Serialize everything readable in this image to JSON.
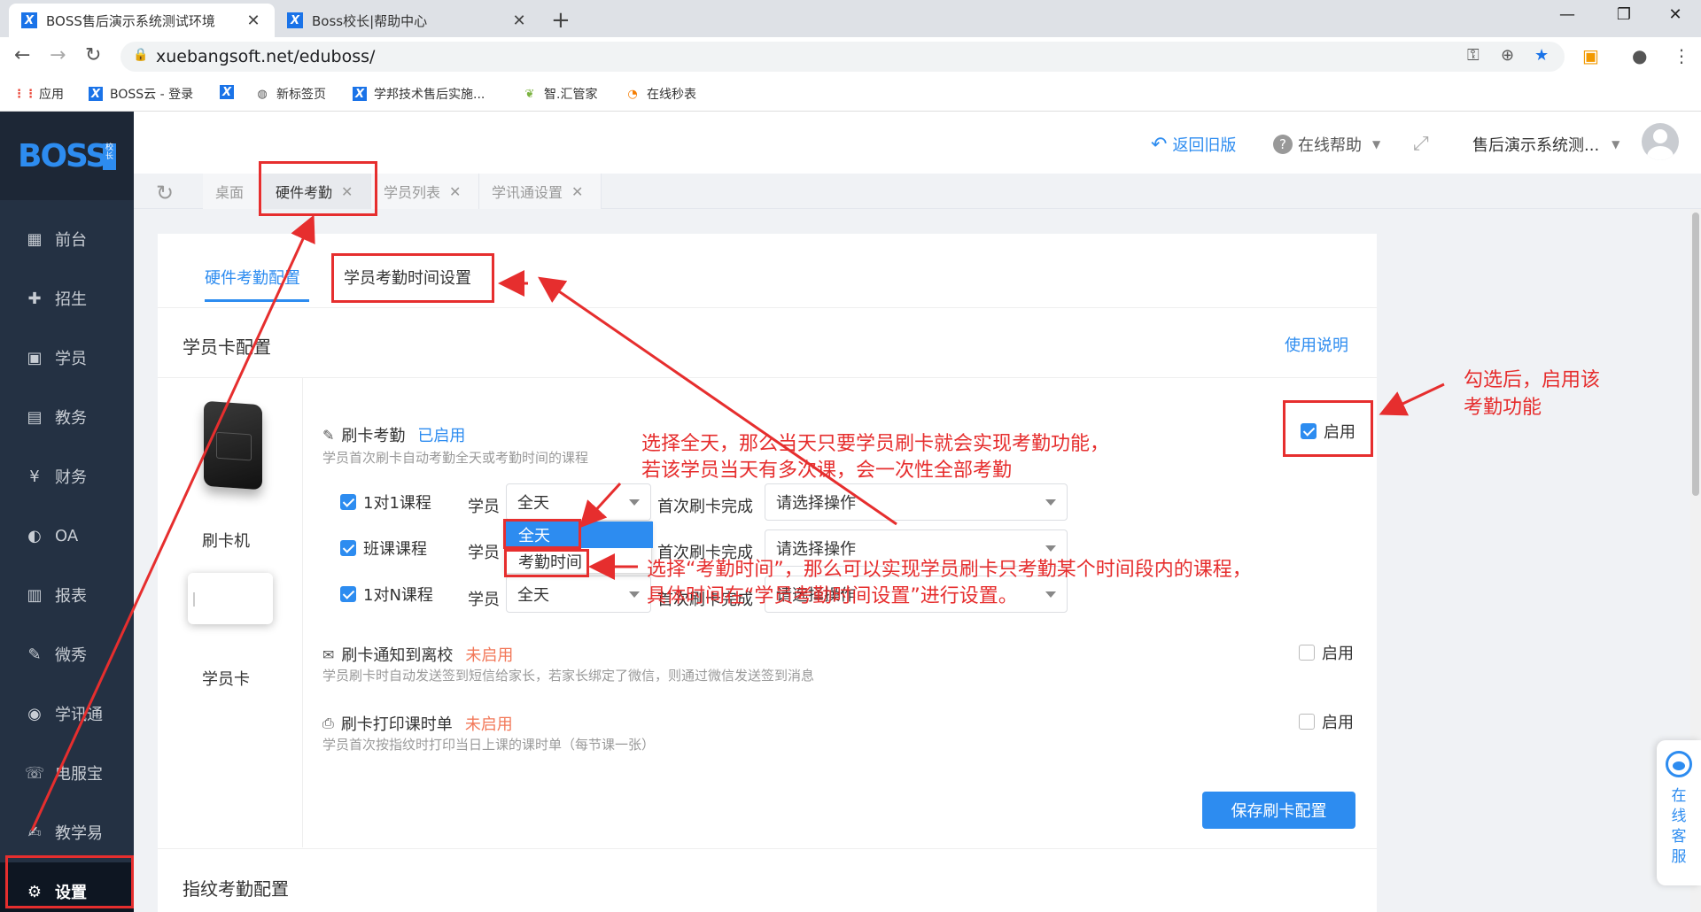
{
  "browser": {
    "tabs": [
      {
        "title": "BOSS售后演示系统测试环境",
        "active": true
      },
      {
        "title": "Boss校长|帮助中心",
        "active": false
      }
    ],
    "new_tab": "+",
    "url": "xuebangsoft.net/eduboss/",
    "window_controls": {
      "minimize": "—",
      "restore": "❐",
      "close": "✕"
    }
  },
  "bookmarks": [
    {
      "label": "应用",
      "icon": "apps-grid-icon"
    },
    {
      "label": "BOSS云 - 登录",
      "icon": "x-icon"
    },
    {
      "label": "",
      "icon": "x-icon"
    },
    {
      "label": "新标签页",
      "icon": "globe-icon"
    },
    {
      "label": "学邦技术售后实施...",
      "icon": "x-icon"
    },
    {
      "label": "智.汇管家",
      "icon": "leaf-icon"
    },
    {
      "label": "在线秒表",
      "icon": "stopwatch-icon"
    }
  ],
  "sidebar": {
    "logo": "BOSS",
    "logo_sub": "校长",
    "items": [
      {
        "label": "前台",
        "icon": "calendar-icon",
        "active": false
      },
      {
        "label": "招生",
        "icon": "add-user-icon",
        "active": false
      },
      {
        "label": "学员",
        "icon": "student-icon",
        "active": false
      },
      {
        "label": "教务",
        "icon": "book-icon",
        "active": false
      },
      {
        "label": "财务",
        "icon": "yen-icon",
        "active": false
      },
      {
        "label": "OA",
        "icon": "oa-icon",
        "active": false
      },
      {
        "label": "报表",
        "icon": "bar-chart-icon",
        "active": false
      },
      {
        "label": "微秀",
        "icon": "xiu-icon",
        "active": false
      },
      {
        "label": "学讯通",
        "icon": "location-icon",
        "active": false
      },
      {
        "label": "电服宝",
        "icon": "phone-icon",
        "active": false
      },
      {
        "label": "教学易",
        "icon": "teach-icon",
        "active": false
      },
      {
        "label": "设置",
        "icon": "gear-icon",
        "active": true
      }
    ]
  },
  "header": {
    "back_old": "返回旧版",
    "help": "在线帮助",
    "user": "售后演示系统测..."
  },
  "page_tabs": [
    {
      "label": "桌面",
      "closable": false
    },
    {
      "label": "硬件考勤",
      "closable": true,
      "active": true
    },
    {
      "label": "学员列表",
      "closable": true
    },
    {
      "label": "学讯通设置",
      "closable": true
    }
  ],
  "content": {
    "tabs": [
      "硬件考勤配置",
      "学员考勤时间设置"
    ],
    "section1_title": "学员卡配置",
    "usage_link": "使用说明",
    "devices": [
      "刷卡机",
      "学员卡"
    ],
    "swipe": {
      "title": "刷卡考勤",
      "status": "已启用",
      "desc": "学员首次刷卡自动考勤全天或考勤时间的课程",
      "enable_label": "启用",
      "rows": [
        {
          "course": "1对1课程",
          "who": "学员",
          "scope": "全天",
          "after": "首次刷卡完成",
          "op": "请选择操作"
        },
        {
          "course": "班课课程",
          "who": "学员",
          "scope": "全天",
          "after": "首次刷卡完成",
          "op": "请选择操作"
        },
        {
          "course": "1对N课程",
          "who": "学员",
          "scope": "全天",
          "after": "首次刷卡完成",
          "op": "请选择操作"
        }
      ],
      "dropdown_options": [
        "全天",
        "考勤时间"
      ]
    },
    "notify": {
      "title": "刷卡通知到离校",
      "status": "未启用",
      "desc": "学员刷卡时自动发送签到短信给家长，若家长绑定了微信，则通过微信发送签到消息",
      "enable_label": "启用"
    },
    "print": {
      "title": "刷卡打印课时单",
      "status": "未启用",
      "desc": "学员首次按指纹时打印当日上课的课时单（每节课一张）",
      "enable_label": "启用"
    },
    "save_button": "保存刷卡配置",
    "section2_title": "指纹考勤配置"
  },
  "online_service": "在线客服",
  "annotations": {
    "checkbox_note_1": "勾选后，启用该",
    "checkbox_note_2": "考勤功能",
    "allday_note_1": "选择全天，那么当天只要学员刷卡就会实现考勤功能，",
    "allday_note_2": "若该学员当天有多次课，会一次性全部考勤",
    "time_note_1": "选择“考勤时间”，那么可以实现学员刷卡只考勤某个时间段内的课程，",
    "time_note_2": "具体时间在“学员考勤时间设置”进行设置。"
  },
  "colors": {
    "accent": "#2d8cf0",
    "sidebar": "#243143",
    "annotation": "#e62e2e"
  }
}
